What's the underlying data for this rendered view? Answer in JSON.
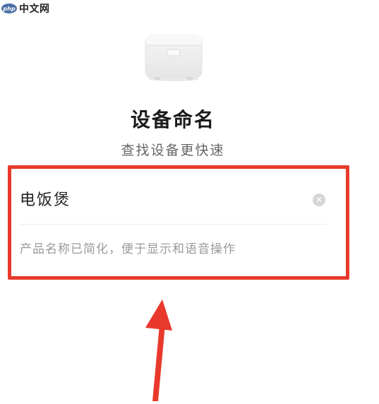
{
  "watermark": {
    "logo": "php",
    "text": "中文网"
  },
  "device": {
    "icon": "rice-cooker-icon"
  },
  "header": {
    "title": "设备命名",
    "subtitle": "查找设备更快速"
  },
  "name_field": {
    "value": "电饭煲",
    "clear_icon": "clear-icon",
    "hint": "产品名称已简化，便于显示和语音操作"
  },
  "annotation": {
    "highlight_color": "#e8392c",
    "arrow_color": "#e8392c"
  }
}
